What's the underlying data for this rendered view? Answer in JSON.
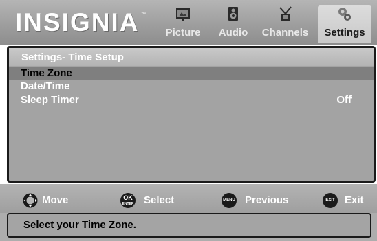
{
  "brand": {
    "logo": "INSIGNIA",
    "tm": "™"
  },
  "menu": [
    {
      "id": "picture",
      "label": "Picture",
      "icon": "picture-icon",
      "active": false
    },
    {
      "id": "audio",
      "label": "Audio",
      "icon": "speaker-icon",
      "active": false
    },
    {
      "id": "channels",
      "label": "Channels",
      "icon": "antenna-icon",
      "active": false
    },
    {
      "id": "settings",
      "label": "Settings",
      "icon": "gears-icon",
      "active": true
    }
  ],
  "panel": {
    "title": "Settings- Time Setup",
    "items": [
      {
        "label": "Time Zone",
        "value": "",
        "selected": true
      },
      {
        "label": "Date/Time",
        "value": "",
        "selected": false
      },
      {
        "label": "Sleep Timer",
        "value": "Off",
        "selected": false
      }
    ]
  },
  "help": {
    "move": "Move",
    "select": "Select",
    "previous": "Previous",
    "exit": "Exit",
    "ok_key": "OK",
    "enter_key": "ENTER",
    "menu_key": "MENU",
    "exit_key": "EXIT"
  },
  "status": "Select your Time Zone.",
  "colors": {
    "selected_row": "#7f7f7f",
    "panel_bg": "#a3a3a3",
    "border": "#1a1a1a"
  }
}
